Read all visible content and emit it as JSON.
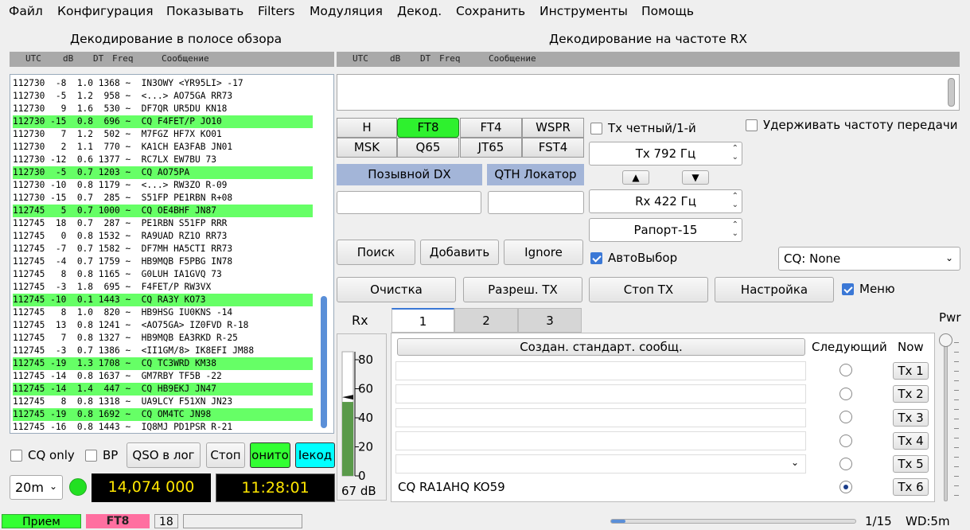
{
  "menu": [
    "Файл",
    "Конфигурация",
    "Показывать",
    "Filters",
    "Модуляция",
    "Декод.",
    "Сохранить",
    "Инструменты",
    "Помощь"
  ],
  "band_title": "Декодирование в полосе обзора",
  "rx_title": "Декодирование на частоте RX",
  "cols": {
    "utc": "UTC",
    "db": "dB",
    "dt": "DT",
    "freq": "Freq",
    "msg": "Сообщение"
  },
  "decodes": [
    {
      "t": "112730  -8  1.0 1368 ~  IN3OWY <YR95LI> -17",
      "cq": false
    },
    {
      "t": "112730  -5  1.2  958 ~  <...> AO75GA RR73",
      "cq": false
    },
    {
      "t": "112730   9  1.6  530 ~  DF7QR UR5DU KN18",
      "cq": false
    },
    {
      "t": "112730 -15  0.8  696 ~  CQ F4FET/P JO10",
      "cq": true
    },
    {
      "t": "112730   7  1.2  502 ~  M7FGZ HF7X KO01",
      "cq": false
    },
    {
      "t": "112730   2  1.1  770 ~  KA1CH EA3FAB JN01",
      "cq": false
    },
    {
      "t": "112730 -12  0.6 1377 ~  RC7LX EW7BU 73",
      "cq": false
    },
    {
      "t": "112730  -5  0.7 1203 ~  CQ AO75PA",
      "cq": true
    },
    {
      "t": "112730 -10  0.8 1179 ~  <...> RW3ZO R-09",
      "cq": false
    },
    {
      "t": "112730 -15  0.7  285 ~  S51FP PE1RBN R+08",
      "cq": false
    },
    {
      "t": "112745   5  0.7 1000 ~  CQ OE4BHF JN87",
      "cq": true
    },
    {
      "t": "112745  18  0.7  287 ~  PE1RBN S51FP RRR",
      "cq": false
    },
    {
      "t": "112745   0  0.8 1532 ~  RA9UAD RZ1O RR73",
      "cq": false
    },
    {
      "t": "112745  -7  0.7 1582 ~  DF7MH HA5CTI RR73",
      "cq": false
    },
    {
      "t": "112745  -4  0.7 1759 ~  HB9MQB F5PBG IN78",
      "cq": false
    },
    {
      "t": "112745   8  0.8 1165 ~  G0LUH IA1GVQ 73",
      "cq": false
    },
    {
      "t": "112745  -3  1.8  695 ~  F4FET/P RW3VX",
      "cq": false
    },
    {
      "t": "112745 -10  0.1 1443 ~  CQ RA3Y KO73",
      "cq": true
    },
    {
      "t": "112745   8  1.0  820 ~  HB9HSG IU0KNS -14",
      "cq": false
    },
    {
      "t": "112745  13  0.8 1241 ~  <AO75GA> IZ0FVD R-18",
      "cq": false
    },
    {
      "t": "112745   7  0.8 1327 ~  HB9MQB EA3RKD R-25",
      "cq": false
    },
    {
      "t": "112745  -3  0.7 1386 ~  <II1GM/8> IK8EFI JM88",
      "cq": false
    },
    {
      "t": "112745 -19  1.3 1708 ~  CQ TC3WRD KM38",
      "cq": true
    },
    {
      "t": "112745 -14  0.8 1637 ~  GM7RBY TF5B -22",
      "cq": false
    },
    {
      "t": "112745 -14  1.4  447 ~  CQ HB9EKJ JN47",
      "cq": true
    },
    {
      "t": "112745   8  0.8 1318 ~  UA9LCY F51XN JN23",
      "cq": false
    },
    {
      "t": "112745 -19  0.8 1692 ~  CQ OM4TC JN98",
      "cq": true
    },
    {
      "t": "112745 -16  0.8 1443 ~  IQ8MJ PD1PSR R-21",
      "cq": false
    }
  ],
  "left_controls": {
    "cq_only": "CQ only",
    "bp": "BP",
    "qso_log": "QSO в лог",
    "stop": "Стоп",
    "monitor": "онитo",
    "decode": "Іекод",
    "band": "20m",
    "freq": "14,074 000",
    "time": "11:28:01"
  },
  "modes": [
    "H",
    "FT8",
    "FT4",
    "WSPR",
    "MSK",
    "Q65",
    "JT65",
    "FST4"
  ],
  "active_mode": "FT8",
  "dx_call_label": "Позывной DX",
  "qth_label": "QTH Локатор",
  "search": "Поиск",
  "add": "Добавить",
  "ignore": "Ignore",
  "clear": "Очистка",
  "enable_tx": "Разреш. TX",
  "stop_tx": "Стоп TX",
  "settings": "Настройка",
  "menu_chk": "Меню",
  "tx_even": "Tx четный/1-й",
  "hold_tx": "Удерживать частоту передачи",
  "tx_freq": "Tx  792  Гц",
  "rx_freq": "Rx  422  Гц",
  "report": "Рапорт-15",
  "up": "▲",
  "down": "▼",
  "auto_seq": "АвтоВыбор",
  "cq_sel": "CQ: None",
  "rx_label": "Rx",
  "meter": {
    "ticks": [
      "80",
      "60",
      "40",
      "20",
      "0"
    ],
    "level_db": 67,
    "db_text": "67 dB"
  },
  "tabs": [
    "1",
    "2",
    "3"
  ],
  "gen_msgs": "Создан. стандарт. сообщ.",
  "next": "Следующий",
  "now": "Now",
  "tx_buttons": [
    "Tx 1",
    "Tx 2",
    "Tx 3",
    "Tx 4",
    "Tx 5",
    "Tx 6"
  ],
  "tx6_msg": "CQ RA1AHQ KO59",
  "pwr": "Pwr",
  "status": {
    "rx": "Прием",
    "mode": "FT8",
    "num": "18",
    "page": "1/15",
    "wd": "WD:5m"
  },
  "colors": {
    "green": "#66ff66",
    "pink": "#ff6fa0",
    "cyan": "#00ffff",
    "accent": "#3b78d6"
  }
}
